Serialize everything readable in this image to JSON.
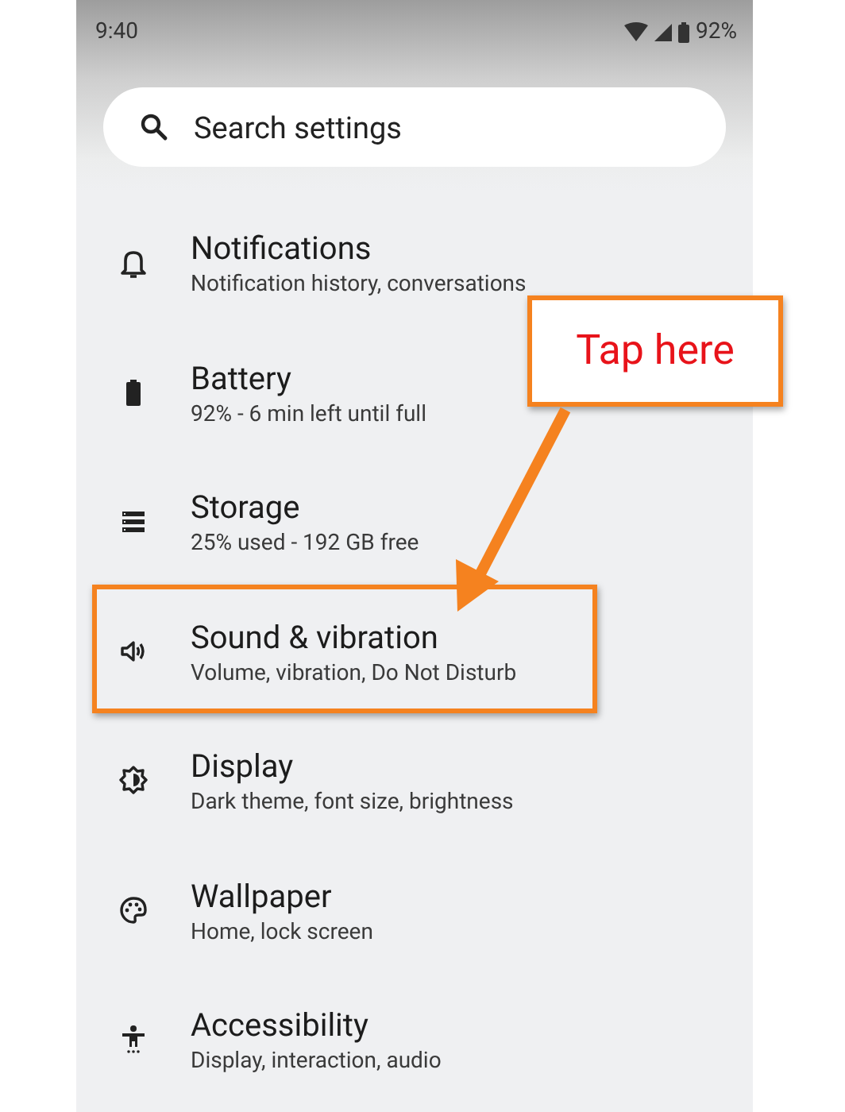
{
  "status_bar": {
    "time": "9:40",
    "battery": "92%"
  },
  "search": {
    "placeholder": "Search settings"
  },
  "items": [
    {
      "kind": "bell",
      "title": "Notifications",
      "subtitle": "Notification history, conversations",
      "highlighted": false
    },
    {
      "kind": "battery",
      "title": "Battery",
      "subtitle": "92% - 6 min left until full",
      "highlighted": false
    },
    {
      "kind": "storage",
      "title": "Storage",
      "subtitle": "25% used - 192 GB free",
      "highlighted": false
    },
    {
      "kind": "sound",
      "title": "Sound & vibration",
      "subtitle": "Volume, vibration, Do Not Disturb",
      "highlighted": true
    },
    {
      "kind": "display",
      "title": "Display",
      "subtitle": "Dark theme, font size, brightness",
      "highlighted": false
    },
    {
      "kind": "palette",
      "title": "Wallpaper",
      "subtitle": "Home, lock screen",
      "highlighted": false
    },
    {
      "kind": "accessibility",
      "title": "Accessibility",
      "subtitle": "Display, interaction, audio",
      "highlighted": false
    }
  ],
  "callout": {
    "text": "Tap here"
  }
}
